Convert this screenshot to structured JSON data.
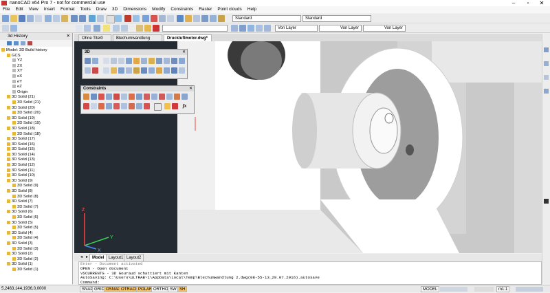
{
  "window": {
    "title": "nanoCAD x64 Pro 7 - not for commercial use"
  },
  "menu": [
    "File",
    "Edit",
    "View",
    "Insert",
    "Format",
    "Tools",
    "Draw",
    "3D",
    "Dimensions",
    "Modify",
    "Constraints",
    "Raster",
    "Point clouds",
    "Help"
  ],
  "toolbar": {
    "textstyle": "Standard",
    "dimstyle": "Standard",
    "layer_color": "Von Layer",
    "linetype": "Von Layer",
    "lineweight": "Von Layer"
  },
  "leftpanel": {
    "title": "3d History",
    "tree": [
      {
        "label": "Model: 3D Build history",
        "level": 0
      },
      {
        "label": "GCS",
        "level": 1
      },
      {
        "label": "YZ",
        "level": 2
      },
      {
        "label": "ZX",
        "level": 2
      },
      {
        "label": "XY",
        "level": 2
      },
      {
        "label": "eX",
        "level": 2
      },
      {
        "label": "eY",
        "level": 2
      },
      {
        "label": "eZ",
        "level": 2
      },
      {
        "label": "Origin",
        "level": 2
      },
      {
        "label": "3D Solid (21)",
        "level": 1
      },
      {
        "label": "3D Solid (21)",
        "level": 2
      },
      {
        "label": "3D Solid (20)",
        "level": 1
      },
      {
        "label": "3D Solid (20)",
        "level": 2
      },
      {
        "label": "3D Solid (19)",
        "level": 1
      },
      {
        "label": "3D Solid (19)",
        "level": 2
      },
      {
        "label": "3D Solid (18)",
        "level": 1
      },
      {
        "label": "3D Solid (18)",
        "level": 2
      },
      {
        "label": "3D Solid (17)",
        "level": 1
      },
      {
        "label": "3D Solid (16)",
        "level": 1
      },
      {
        "label": "3D Solid (15)",
        "level": 1
      },
      {
        "label": "3D Solid (14)",
        "level": 1
      },
      {
        "label": "3D Solid (13)",
        "level": 1
      },
      {
        "label": "3D Solid (12)",
        "level": 1
      },
      {
        "label": "3D Solid (11)",
        "level": 1
      },
      {
        "label": "3D Solid (10)",
        "level": 1
      },
      {
        "label": "3D Solid (9)",
        "level": 1
      },
      {
        "label": "3D Solid (9)",
        "level": 2
      },
      {
        "label": "3D Solid (8)",
        "level": 1
      },
      {
        "label": "3D Solid (8)",
        "level": 2
      },
      {
        "label": "3D Solid (7)",
        "level": 1
      },
      {
        "label": "3D Solid (7)",
        "level": 2
      },
      {
        "label": "3D Solid (6)",
        "level": 1
      },
      {
        "label": "3D Solid (6)",
        "level": 2
      },
      {
        "label": "3D Solid (5)",
        "level": 1
      },
      {
        "label": "3D Solid (5)",
        "level": 2
      },
      {
        "label": "3D Solid (4)",
        "level": 1
      },
      {
        "label": "3D Solid (4)",
        "level": 2
      },
      {
        "label": "3D Solid (3)",
        "level": 1
      },
      {
        "label": "3D Solid (3)",
        "level": 2
      },
      {
        "label": "3D Solid (2)",
        "level": 1
      },
      {
        "label": "3D Solid (2)",
        "level": 2
      },
      {
        "label": "3D Solid (1)",
        "level": 1
      },
      {
        "label": "3D Solid (1)",
        "level": 2
      }
    ]
  },
  "doctabs": [
    "Ohne Titel0",
    "Blechumwandlung 2.dwg",
    "Druckluftmotor.dwg*"
  ],
  "panels": {
    "three_d": "3D",
    "constraints": "Constraints"
  },
  "axes": {
    "z": "Z",
    "y": "Y",
    "x": "X"
  },
  "layouttabs": [
    "Model",
    "Layout1",
    "Layout2"
  ],
  "command": {
    "lines": [
      "Enter - Document activated",
      "OPEN - Open document",
      "VSCURRENTG - 3D Gouraud schattiert mit Kanten",
      "AutoSaving: C:\\Users\\ULTRAB~1\\AppData\\Local\\Temp\\Blechumwandlung 2.dwg(08-55-13_29.07.2016).autosave"
    ],
    "prompt": "Command:"
  },
  "status": {
    "coords": "5,2463,144,1936,0,0000",
    "buttons": [
      "SNAP",
      "GRID",
      "OSNAP",
      "OTRACK",
      "POLAR",
      "ORTHO",
      "SW",
      "SH"
    ],
    "active": [
      false,
      false,
      true,
      true,
      true,
      false,
      false,
      true
    ],
    "mode": "MODEL",
    "scale": "m1:1"
  },
  "colors": {
    "viewport": "#252b33",
    "accent": "#f4c36b"
  }
}
